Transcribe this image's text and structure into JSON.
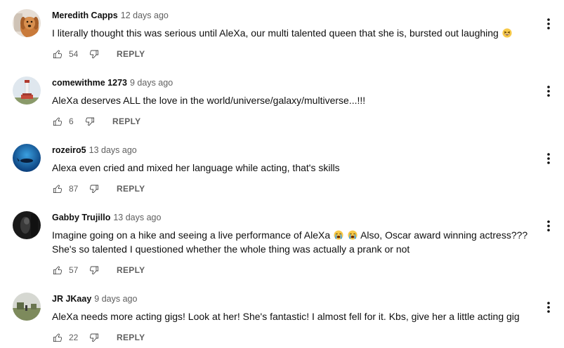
{
  "comments": [
    {
      "author": "Meredith Capps",
      "time": "12 days ago",
      "text": "I literally thought this was serious until AleXa, our multi talented queen that she is, bursted out laughing",
      "emoji": [
        "grinning-squint-face"
      ],
      "likes": "54",
      "reply": "REPLY",
      "avatar": "avatar-dog"
    },
    {
      "author": "comewithme 1273",
      "time": "9 days ago",
      "text": "AleXa deserves ALL the love in the world/universe/galaxy/multiverse...!!!",
      "likes": "6",
      "reply": "REPLY",
      "avatar": "avatar-lighthouse"
    },
    {
      "author": "rozeiro5",
      "time": "13 days ago",
      "text": "Alexa even cried and mixed her language while acting, that's skills",
      "likes": "87",
      "reply": "REPLY",
      "avatar": "avatar-ocean"
    },
    {
      "author": "Gabby Trujillo",
      "time": "13 days ago",
      "text_line1_a": "Imagine going on a hike and seeing a live performance of AleXa",
      "text_line1_b": "Also, Oscar award winning actress???",
      "text_line2": "She's so talented I questioned whether the whole thing was actually a prank or not",
      "emoji": [
        "loudly-crying-face",
        "loudly-crying-face"
      ],
      "likes": "57",
      "reply": "REPLY",
      "avatar": "avatar-dark-portrait"
    },
    {
      "author": "JR JKaay",
      "time": "9 days ago",
      "text": "AleXa needs more acting gigs! Look at her! She's fantastic! I almost fell for it. Kbs, give her a little acting gig",
      "likes": "22",
      "reply": "REPLY",
      "avatar": "avatar-landscape"
    }
  ],
  "colors": {
    "text_primary": "#0f0f0f",
    "text_secondary": "#606060",
    "background": "#ffffff"
  }
}
